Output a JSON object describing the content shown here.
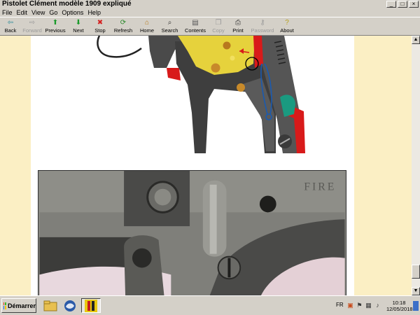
{
  "window": {
    "title": "Pistolet Clément modèle 1909 expliqué",
    "controls": [
      "_",
      "□",
      "×"
    ]
  },
  "menu": [
    "File",
    "Edit",
    "View",
    "Go",
    "Options",
    "Help"
  ],
  "toolbar": [
    {
      "label": "Back",
      "icon": "back-arrow-icon",
      "glyph": "⇦",
      "color": "#2a8a9a",
      "enabled": true,
      "w": 30
    },
    {
      "label": "Forward",
      "icon": "forward-arrow-icon",
      "glyph": "⇨",
      "color": "#9a9a9a",
      "enabled": false,
      "w": 32
    },
    {
      "label": "Previous",
      "icon": "up-arrow-icon",
      "glyph": "⬆",
      "color": "#1a9a2a",
      "enabled": true,
      "w": 34
    },
    {
      "label": "Next",
      "icon": "down-arrow-icon",
      "glyph": "⬇",
      "color": "#1a9a2a",
      "enabled": true,
      "w": 32
    },
    {
      "label": "Stop",
      "icon": "stop-icon",
      "glyph": "✖",
      "color": "#d42020",
      "enabled": true,
      "w": 30
    },
    {
      "label": "Refresh",
      "icon": "refresh-icon",
      "glyph": "⟳",
      "color": "#2a8a2a",
      "enabled": true,
      "w": 36
    },
    {
      "label": "Home",
      "icon": "home-icon",
      "glyph": "⌂",
      "color": "#b87a1a",
      "enabled": true,
      "w": 32
    },
    {
      "label": "Search",
      "icon": "search-icon",
      "glyph": "⌕",
      "color": "#333333",
      "enabled": true,
      "w": 33
    },
    {
      "label": "Contents",
      "icon": "contents-icon",
      "glyph": "▤",
      "color": "#555555",
      "enabled": true,
      "w": 40
    },
    {
      "label": "Copy",
      "icon": "copy-icon",
      "glyph": "❐",
      "color": "#9a9a9a",
      "enabled": false,
      "w": 26
    },
    {
      "label": "Print",
      "icon": "print-icon",
      "glyph": "⎙",
      "color": "#333333",
      "enabled": true,
      "w": 30
    },
    {
      "label": "Password",
      "icon": "key-icon",
      "glyph": "⚷",
      "color": "#9a9a9a",
      "enabled": false,
      "w": 40
    },
    {
      "label": "About",
      "icon": "help-icon",
      "glyph": "?",
      "color": "#b8a01a",
      "enabled": true,
      "w": 30
    }
  ],
  "content": {
    "photo_stamp": "FIRE"
  },
  "taskbar": {
    "start_label": "Démarrer",
    "lang": "FR",
    "time": "10:18",
    "date": "12/05/2018"
  }
}
